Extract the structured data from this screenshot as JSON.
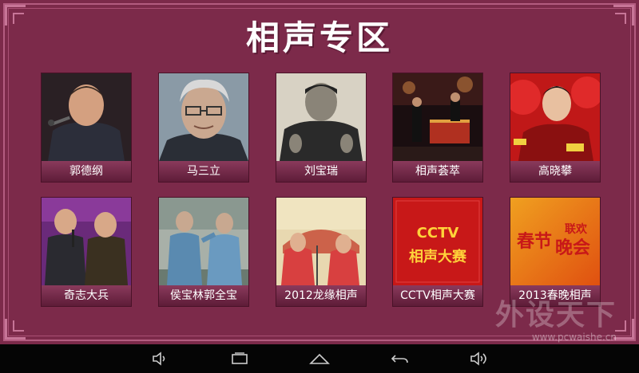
{
  "page": {
    "title": "相声专区"
  },
  "tiles": [
    {
      "label": "郭德纲",
      "thumb": "portrait-performer"
    },
    {
      "label": "马三立",
      "thumb": "portrait-elder"
    },
    {
      "label": "刘宝瑞",
      "thumb": "portrait-vintage"
    },
    {
      "label": "相声荟萃",
      "thumb": "stage-performance"
    },
    {
      "label": "高晓攀",
      "thumb": "portrait-red-fans"
    },
    {
      "label": "奇志大兵",
      "thumb": "duo-comedians"
    },
    {
      "label": "侯宝林郭全宝",
      "thumb": "duo-vintage-stage"
    },
    {
      "label": "2012龙缘相声",
      "thumb": "duo-red-robes"
    },
    {
      "label": "CCTV相声大赛",
      "thumb": "cctv-banner",
      "banner_line1": "CCTV",
      "banner_line2": "相声大赛"
    },
    {
      "label": "2013春晚相声",
      "thumb": "chunwan-banner",
      "banner_line1": "春节",
      "banner_line2": "联欢",
      "banner_line3": "晚会"
    }
  ],
  "watermark": {
    "text": "外设天下",
    "url": "www.pcwaishe.cn"
  },
  "navbar": {
    "buttons": [
      "volume-down",
      "recent-apps",
      "home",
      "back",
      "volume-up"
    ]
  },
  "colors": {
    "background": "#7c2a4a",
    "frame": "#b35c80",
    "navbar": "#050505",
    "label_bar": "#6a2240"
  }
}
